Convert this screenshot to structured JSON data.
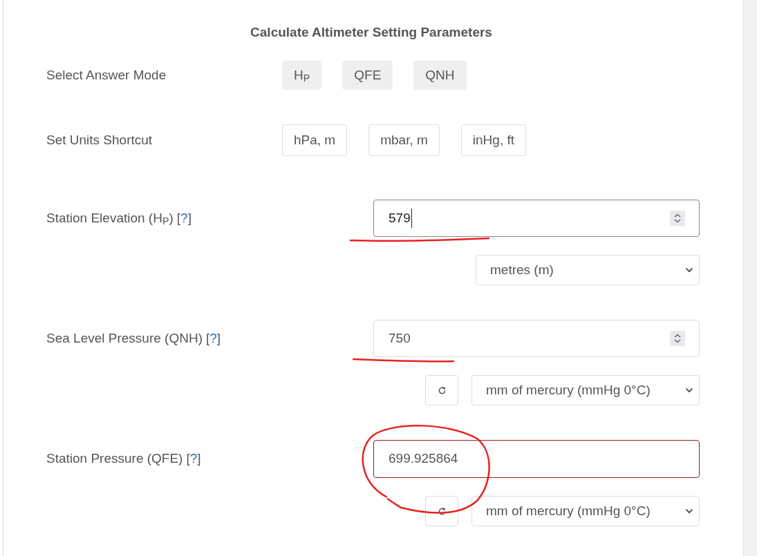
{
  "title": "Calculate Altimeter Setting Parameters",
  "answer_mode": {
    "label": "Select Answer Mode",
    "options": [
      {
        "label": "H$_{P}$",
        "selected": false
      },
      {
        "label": "QFE",
        "selected": false
      },
      {
        "label": "QNH",
        "selected": false
      }
    ]
  },
  "units_shortcut": {
    "label": "Set Units Shortcut",
    "options": [
      "hPa, m",
      "mbar, m",
      "inHg, ft"
    ]
  },
  "fields": [
    {
      "label": "Station Elevation (H$_{P}$)",
      "help": {
        "open": "[",
        "link": "?",
        "close": "]"
      },
      "kind": "number",
      "value": "579",
      "focused": true,
      "unit": "metres (m)",
      "reset": false
    },
    {
      "label": "Sea Level Pressure (QNH)",
      "help": {
        "open": "[",
        "link": "?",
        "close": "]"
      },
      "kind": "number",
      "value": "750",
      "focused": false,
      "unit": "mm of mercury (mmHg 0°C)",
      "reset": true
    },
    {
      "label": "Station Pressure (QFE)",
      "help": {
        "open": "[",
        "link": "?",
        "close": "]"
      },
      "kind": "result",
      "value": "699.925864",
      "focused": false,
      "unit": "mm of mercury (mmHg 0°C)",
      "reset": true
    }
  ]
}
